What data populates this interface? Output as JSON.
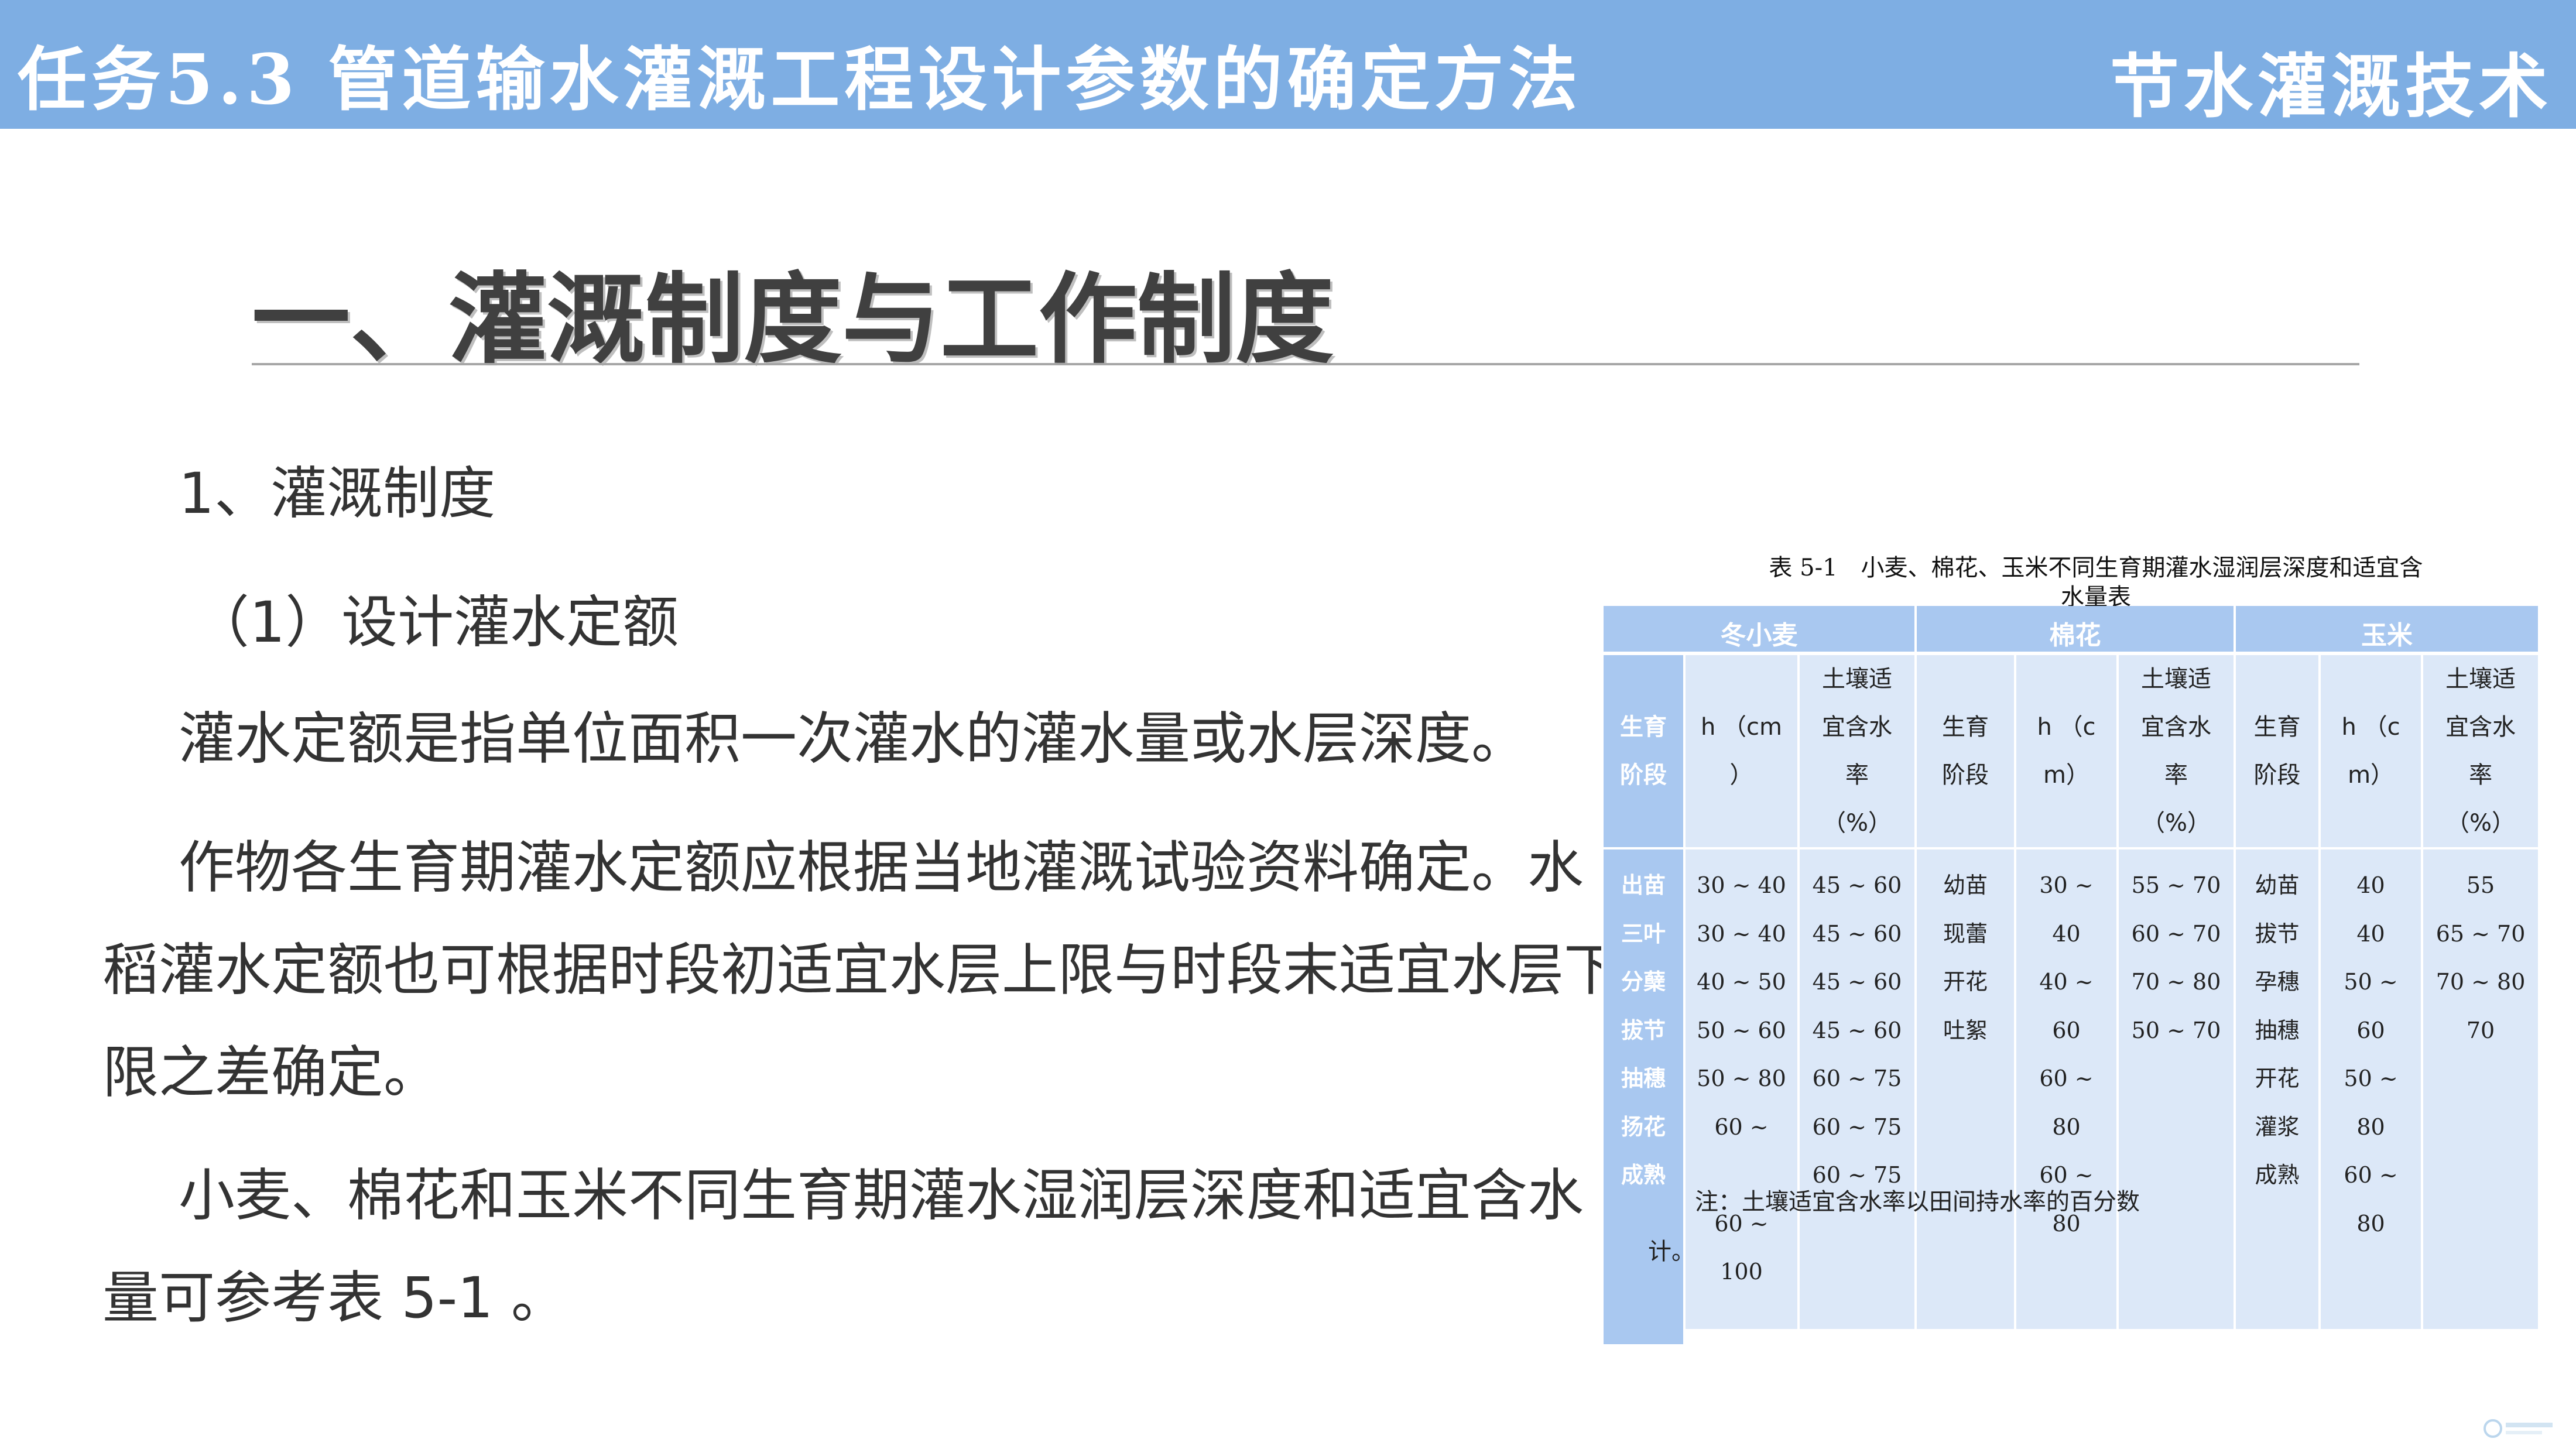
{
  "header": {
    "task_title": "任务5.3  管道输水灌溉工程设计参数的确定方法",
    "course_title": "节水灌溉技术",
    "bar_color": "#7eaee3"
  },
  "section_heading": "一、灌溉制度与工作制度",
  "subheading_1": "1、灌溉制度",
  "subheading_2": "（1）设计灌水定额",
  "paragraphs": [
    {
      "lines": [
        "灌水定额是指单位面积一次灌水的灌水量或水层深度。"
      ]
    },
    {
      "lines": [
        "作物各生育期灌水定额应根据当地灌溉试验资料确定。水",
        "稻灌水定额也可根据时段初适宜水层上限与时段末适宜水层下",
        "限之差确定。"
      ]
    },
    {
      "lines": [
        "小麦、棉花和玉米不同生育期灌水湿润层深度和适宜含水",
        "量可参考表 5-1 。"
      ]
    }
  ],
  "table": {
    "caption_line1": "表 5-1　小麦、棉花、玉米不同生育期灌水湿润层深度和适宜含",
    "caption_line2": "水量表",
    "groups": [
      "冬小麦",
      "棉花",
      "玉米"
    ],
    "header_cells": [
      [
        "生育",
        "阶段"
      ],
      [
        "h （cm",
        "）"
      ],
      [
        "土壤适",
        "宜含水",
        "率",
        "（%）"
      ],
      [
        "生育",
        "阶段"
      ],
      [
        "h （c",
        "m）"
      ],
      [
        "土壤适",
        "宜含水",
        "率",
        "（%）"
      ],
      [
        "生育",
        "阶段"
      ],
      [
        "h （c",
        "m）"
      ],
      [
        "土壤适",
        "宜含水",
        "率",
        "（%）"
      ]
    ],
    "body_columns": [
      [
        "出苗",
        "三叶",
        "分蘖",
        "拔节",
        "抽穗",
        "扬花",
        "成熟"
      ],
      [
        "30 ~ 40",
        "30 ~ 40",
        "40 ~ 50",
        "50 ~ 60",
        "50 ~ 80",
        "60 ~",
        "",
        "60 ~",
        "100"
      ],
      [
        "45 ~ 60",
        "45 ~ 60",
        "45 ~ 60",
        "45 ~ 60",
        "60 ~ 75",
        "60 ~ 75",
        "60 ~ 75"
      ],
      [
        "幼苗",
        "现蕾",
        "开花",
        "吐絮"
      ],
      [
        "30 ~",
        "40",
        "40 ~",
        "60",
        "60 ~",
        "80",
        "60 ~",
        "80"
      ],
      [
        "55 ~ 70",
        "60 ~ 70",
        "70 ~ 80",
        "50 ~ 70"
      ],
      [
        "幼苗",
        "拔节",
        "孕穗",
        "抽穗",
        "开花",
        "灌浆",
        "成熟"
      ],
      [
        "40",
        "40",
        "50 ~",
        "60",
        "50 ~",
        "80",
        "60 ~",
        "80"
      ],
      [
        "55",
        "65 ~ 70",
        "70 ~ 80",
        "70"
      ]
    ],
    "note": "注：土壤适宜含水率以田间持水率的百分数",
    "note_tail": "计。"
  },
  "icons": {
    "corner_logo": "watermark-logo-icon"
  }
}
